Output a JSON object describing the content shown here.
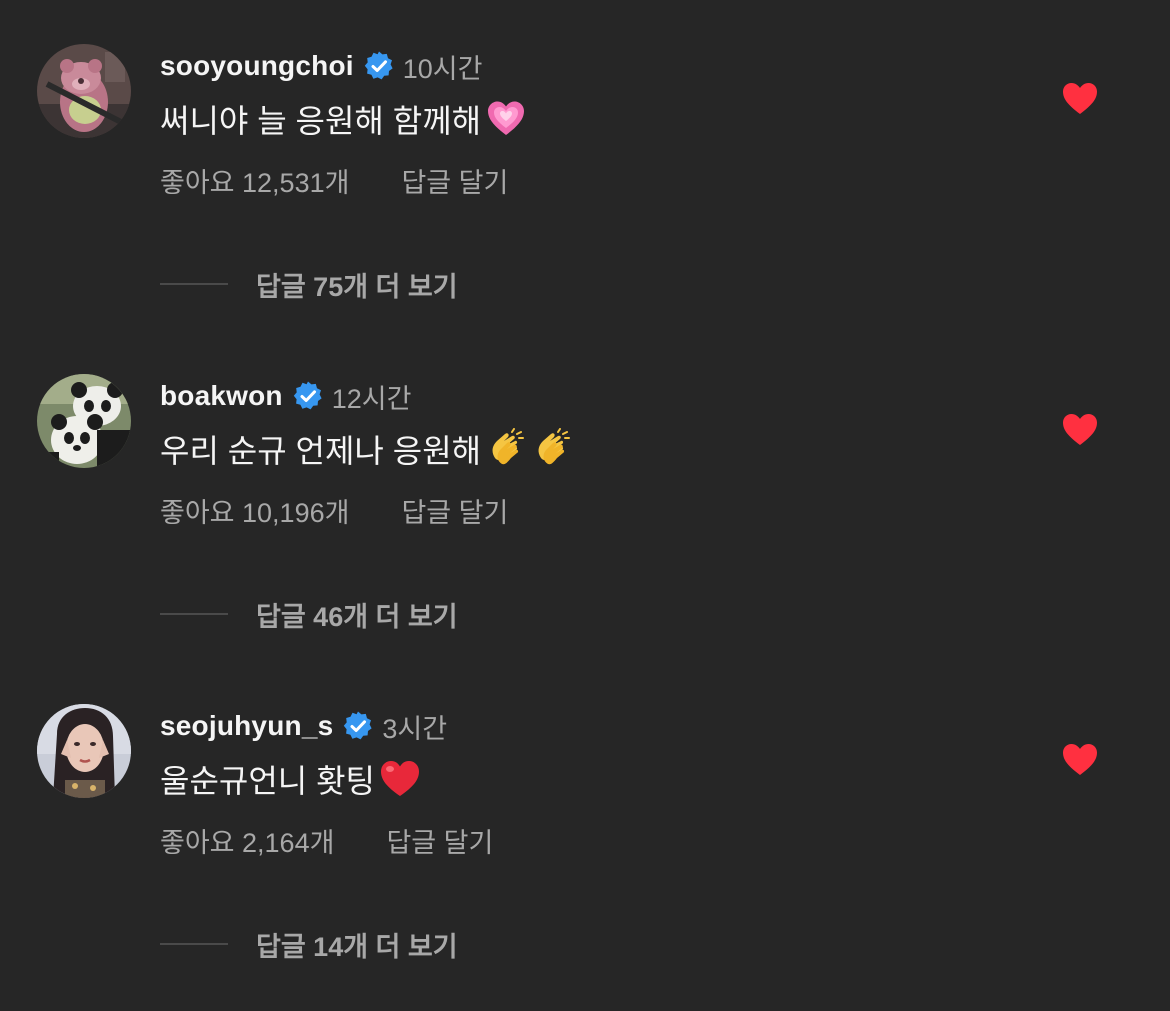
{
  "comments": [
    {
      "username": "sooyoungchoi",
      "verified": true,
      "time": "10시간",
      "text": "써니야 늘 응원해 함께해",
      "emoji": [
        "growing-heart-emoji"
      ],
      "likes_label": "좋아요 12,531개",
      "reply_label": "답글 달기",
      "liked": true,
      "view_replies_label": "답글 75개 더 보기",
      "avatar": "avatar-pink-bear"
    },
    {
      "username": "boakwon",
      "verified": true,
      "time": "12시간",
      "text": "우리 순규 언제나 응원해",
      "emoji": [
        "clapping-hands-emoji",
        "clapping-hands-emoji"
      ],
      "likes_label": "좋아요 10,196개",
      "reply_label": "답글 달기",
      "liked": true,
      "view_replies_label": "답글 46개 더 보기",
      "avatar": "avatar-pandas"
    },
    {
      "username": "seojuhyun_s",
      "verified": true,
      "time": "3시간",
      "text": "울순규언니 홧팅",
      "emoji": [
        "red-heart-emoji"
      ],
      "likes_label": "좋아요 2,164개",
      "reply_label": "답글 달기",
      "liked": true,
      "view_replies_label": "답글 14개 더 보기",
      "avatar": "avatar-portrait"
    }
  ],
  "colors": {
    "background": "#262626",
    "primary_text": "#f5f5f5",
    "secondary_text": "#a8a8a8",
    "verified_badge": "#3797f0",
    "like_heart": "#ff3040",
    "divider_line": "#4a4a4a"
  }
}
